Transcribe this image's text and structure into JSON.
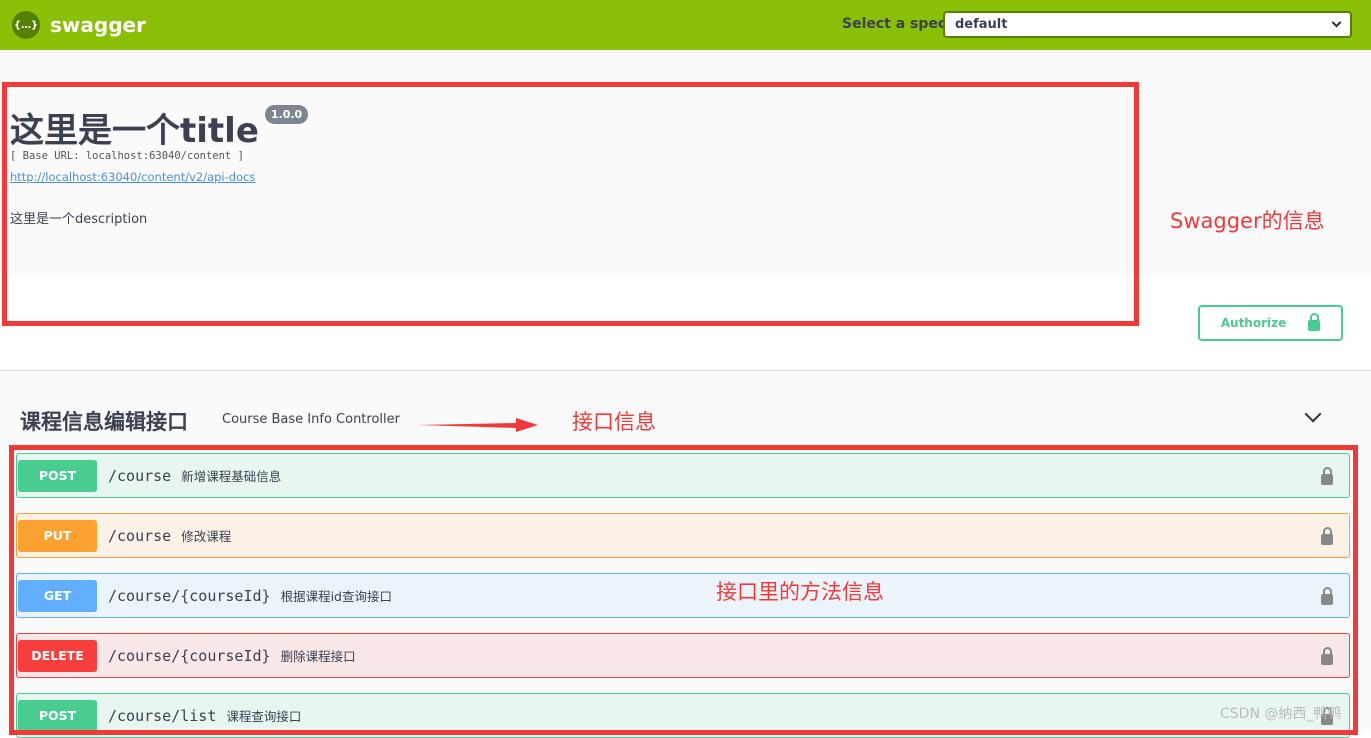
{
  "topbar": {
    "logo_icon": "{…}",
    "brand": "swagger",
    "spec_label": "Select a spec",
    "spec_value": "default"
  },
  "info": {
    "title": "这里是一个title",
    "version": "1.0.0",
    "base_url": "[ Base URL: localhost:63040/content ]",
    "api_docs_link": "http://localhost:63040/content/v2/api-docs",
    "description": "这里是一个description"
  },
  "authorize": {
    "label": "Authorize"
  },
  "tag": {
    "name": "课程信息编辑接口",
    "description": "Course Base Info Controller"
  },
  "operations": [
    {
      "method": "POST",
      "path": "/course",
      "summary": "新增课程基础信息",
      "color": "#49cc90",
      "bg": "#e8f6f0"
    },
    {
      "method": "PUT",
      "path": "/course",
      "summary": "修改课程",
      "color": "#fca130",
      "bg": "#fbf1e6"
    },
    {
      "method": "GET",
      "path": "/course/{courseId}",
      "summary": "根据课程id查询接口",
      "color": "#61affe",
      "bg": "#ebf3fb"
    },
    {
      "method": "DELETE",
      "path": "/course/{courseId}",
      "summary": "删除课程接口",
      "color": "#f93e3e",
      "bg": "#fae7e7"
    },
    {
      "method": "POST",
      "path": "/course/list",
      "summary": "课程查询接口",
      "color": "#49cc90",
      "bg": "#e8f6f0"
    }
  ],
  "annotations": {
    "swagger_info": "Swagger的信息",
    "interface_info": "接口信息",
    "method_info": "接口里的方法信息",
    "color": "#f23939"
  },
  "watermark": "CSDN @纳西_鸭鸭"
}
